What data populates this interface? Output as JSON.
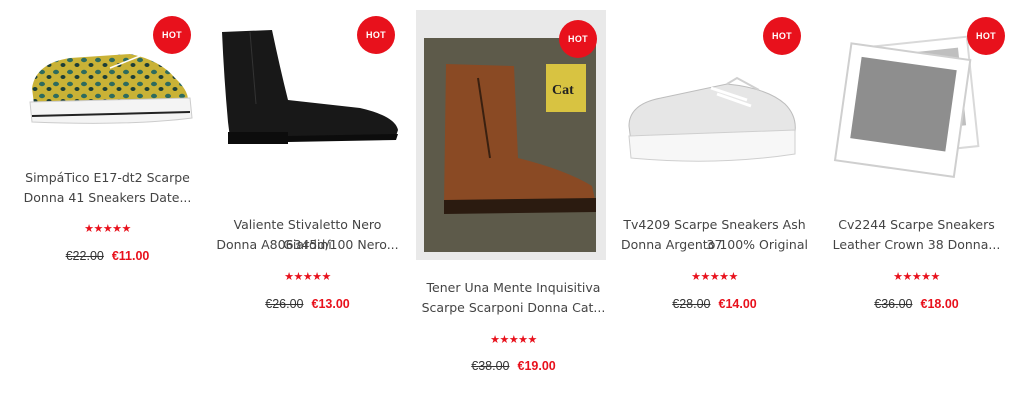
{
  "hot_label": "HOT",
  "rating_glyph": "★★★★★",
  "products": [
    {
      "title_1": "SimpáTico E17-dt2 Scarpe",
      "title_2": "Donna 41 Sneakers Date...",
      "old_price": "€22.00",
      "new_price": "€11.00"
    },
    {
      "title_1": "Valiente Stivaletto Nero Giardini",
      "title_2": "Donna A806345d/100 Nero...",
      "old_price": "€26.00",
      "new_price": "€13.00"
    },
    {
      "title_1": "Tener Una Mente Inquisitiva",
      "title_2": "Scarpe Scarponi Donna Cat...",
      "old_price": "€38.00",
      "new_price": "€19.00"
    },
    {
      "title_1": "Tv4209 Scarpe Sneakers Ash 37",
      "title_2": "Donna Argento 100% Original",
      "old_price": "€28.00",
      "new_price": "€14.00"
    },
    {
      "title_1": "Cv2244 Scarpe Sneakers",
      "title_2": "Leather Crown 38 Donna...",
      "old_price": "€36.00",
      "new_price": "€18.00"
    }
  ],
  "colors": {
    "accent": "#e8111c"
  },
  "icons": [
    "leopard-sneaker-image",
    "black-ankle-boot-image",
    "brown-cat-boot-image",
    "silver-sneaker-image",
    "photo-placeholder-image"
  ]
}
